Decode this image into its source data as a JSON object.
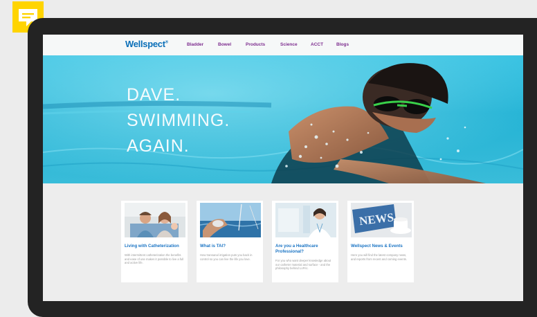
{
  "site": {
    "logo": "Wellspect",
    "logo_mark": "®",
    "nav": [
      "Bladder",
      "Bowel",
      "Products",
      "Science",
      "ACCT",
      "Blogs"
    ]
  },
  "hero": {
    "lines": [
      "DAVE.",
      "SWIMMING.",
      "AGAIN."
    ]
  },
  "cards": [
    {
      "title": "Living with Catheterization",
      "text": "With intermittent catheterization the benefits and ease of use makes it possible to live a full and active life."
    },
    {
      "title": "What is TAI?",
      "text": "How transanal irrigation puts you back in control so you can live the life you love."
    },
    {
      "title": "Are you a Healthcare Professional?",
      "text": "For you who want deeper knowledge about our catheter material and surface - and the philosophy behind LoFric."
    },
    {
      "title": "Wellspect News & Events",
      "text": "Here you will find the latest company news, and reports from recent and coming events."
    }
  ],
  "colors": {
    "note_icon": "#ffd400",
    "tablet_frame": "#232323",
    "nav_link": "#7d2d8f",
    "logo": "#0b6fb8",
    "card_title": "#1a74c4"
  },
  "icons": {
    "note": "sticky-note-icon"
  }
}
